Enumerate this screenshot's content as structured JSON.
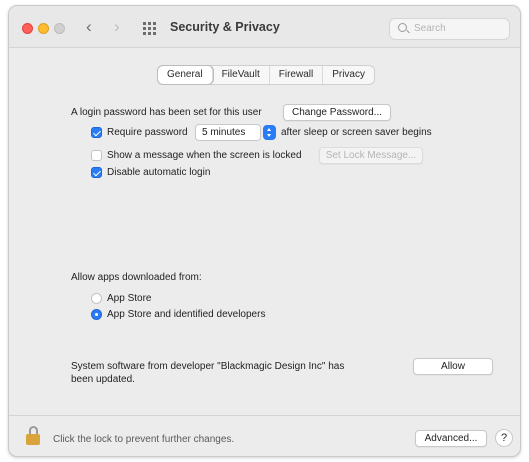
{
  "window": {
    "title": "Security & Privacy",
    "search_placeholder": "Search"
  },
  "tabs": [
    {
      "label": "General",
      "active": true
    },
    {
      "label": "FileVault",
      "active": false
    },
    {
      "label": "Firewall",
      "active": false
    },
    {
      "label": "Privacy",
      "active": false
    }
  ],
  "general": {
    "login_password_text": "A login password has been set for this user",
    "change_password_label": "Change Password...",
    "require_password_label": "Require password",
    "require_password_checked": true,
    "require_password_delay": "5 minutes",
    "after_sleep_text": "after sleep or screen saver begins",
    "show_message_label": "Show a message when the screen is locked",
    "show_message_checked": false,
    "set_lock_message_label": "Set Lock Message...",
    "disable_auto_login_label": "Disable automatic login",
    "disable_auto_login_checked": true
  },
  "allow_apps": {
    "heading": "Allow apps downloaded from:",
    "options": [
      {
        "label": "App Store",
        "selected": false
      },
      {
        "label": "App Store and identified developers",
        "selected": true
      }
    ]
  },
  "system_software": {
    "message_line1": "System software from developer \"Blackmagic Design Inc\" has",
    "message_line2": "been updated.",
    "allow_label": "Allow"
  },
  "footer": {
    "lock_text": "Click the lock to prevent further changes.",
    "advanced_label": "Advanced...",
    "help_label": "?"
  },
  "colors": {
    "accent": "#2a7bf6",
    "window_bg": "#ececec",
    "lock": "#d8a43b"
  }
}
